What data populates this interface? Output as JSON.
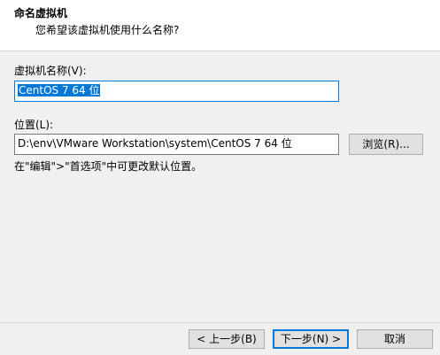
{
  "header": {
    "title": "命名虚拟机",
    "subtitle": "您希望该虚拟机使用什么名称?"
  },
  "name_field": {
    "label": "虚拟机名称(V):",
    "value": "CentOS 7 64 位"
  },
  "location_field": {
    "label": "位置(L):",
    "value": "D:\\env\\VMware Workstation\\system\\CentOS 7 64 位",
    "browse_label": "浏览(R)..."
  },
  "hint": "在\"编辑\">\"首选项\"中可更改默认位置。",
  "footer": {
    "back_label": "< 上一步(B)",
    "next_label": "下一步(N) >",
    "cancel_label": "取消"
  },
  "colors": {
    "accent": "#0078d7",
    "background": "#f0f0f0",
    "header_bg": "#ffffff"
  }
}
